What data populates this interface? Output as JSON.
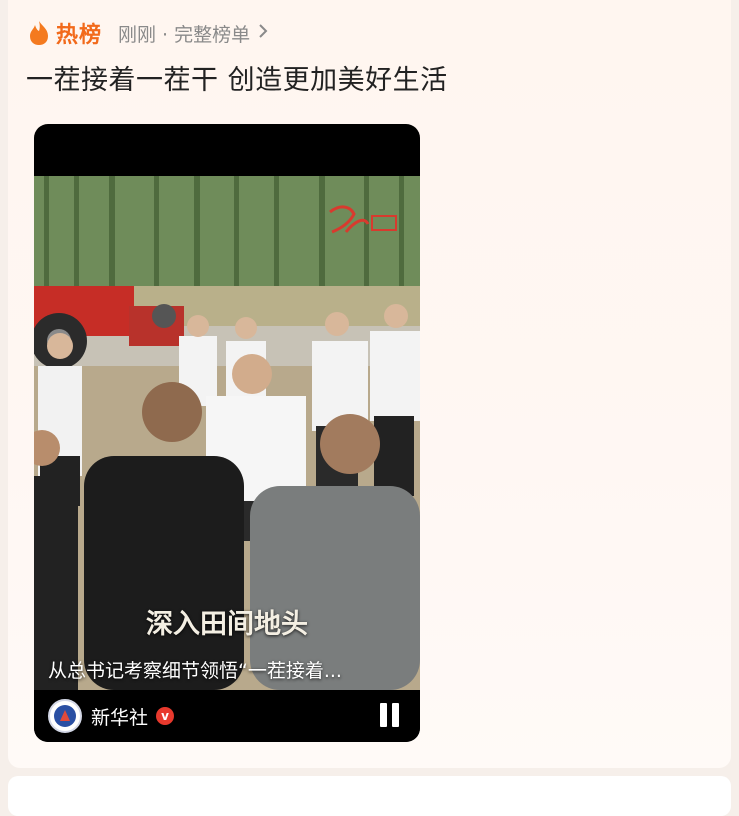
{
  "hot_section": {
    "label": "热榜",
    "meta": "刚刚 · 完整榜单",
    "chevron_icon": "chevron-right-icon",
    "flame_icon": "flame-icon",
    "accent_color": "#f26a1b"
  },
  "headline": "一茬接着一茬干 创造更加美好生活",
  "video": {
    "caption_big": "深入田间地头",
    "caption_small": "从总书记考察细节领悟“一茬接着...",
    "account_name": "新华社",
    "verified_mark": "v",
    "pause_icon": "pause-icon"
  }
}
